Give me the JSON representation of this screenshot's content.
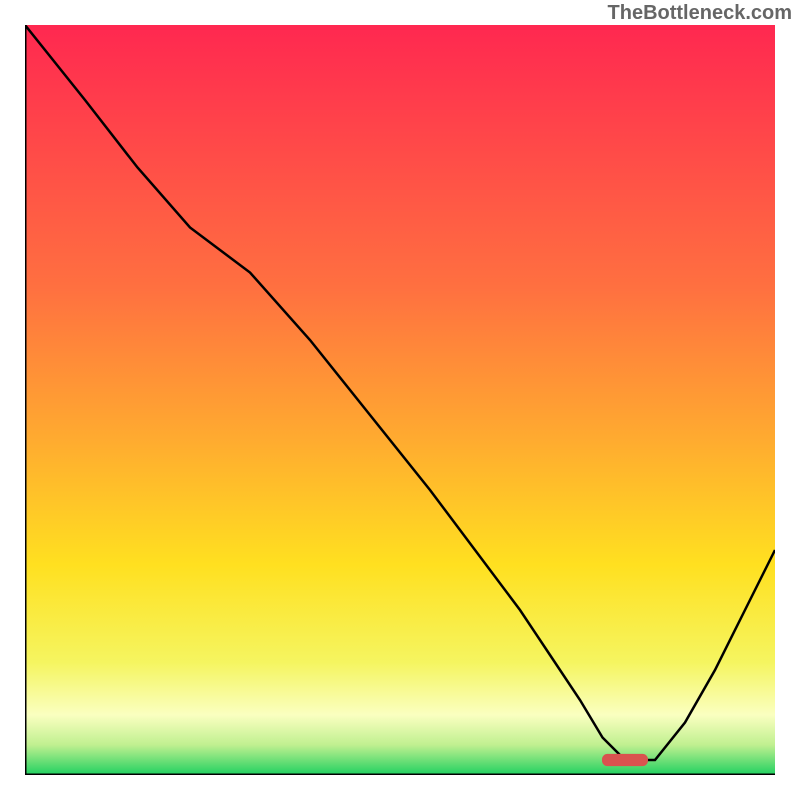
{
  "watermark": "TheBottleneck.com",
  "chart_data": {
    "type": "line",
    "title": "",
    "xlabel": "",
    "ylabel": "",
    "xlim": [
      0,
      100
    ],
    "ylim": [
      0,
      100
    ],
    "series": [
      {
        "name": "bottleneck-curve",
        "x": [
          0,
          8,
          15,
          22,
          30,
          38,
          46,
          54,
          60,
          66,
          70,
          74,
          77,
          80,
          84,
          88,
          92,
          96,
          100
        ],
        "y": [
          100,
          90,
          81,
          73,
          67,
          58,
          48,
          38,
          30,
          22,
          16,
          10,
          5,
          2,
          2,
          7,
          14,
          22,
          30
        ]
      }
    ],
    "marker": {
      "x": 80,
      "y": 2,
      "width": 6,
      "height": 1.5
    },
    "gradient_bands": [
      {
        "offset": 0,
        "color": "#ff2850"
      },
      {
        "offset": 0.35,
        "color": "#ff7040"
      },
      {
        "offset": 0.55,
        "color": "#ffaa30"
      },
      {
        "offset": 0.72,
        "color": "#ffe020"
      },
      {
        "offset": 0.85,
        "color": "#f5f560"
      },
      {
        "offset": 0.92,
        "color": "#faffc0"
      },
      {
        "offset": 0.96,
        "color": "#c0f090"
      },
      {
        "offset": 1.0,
        "color": "#20d060"
      }
    ]
  }
}
